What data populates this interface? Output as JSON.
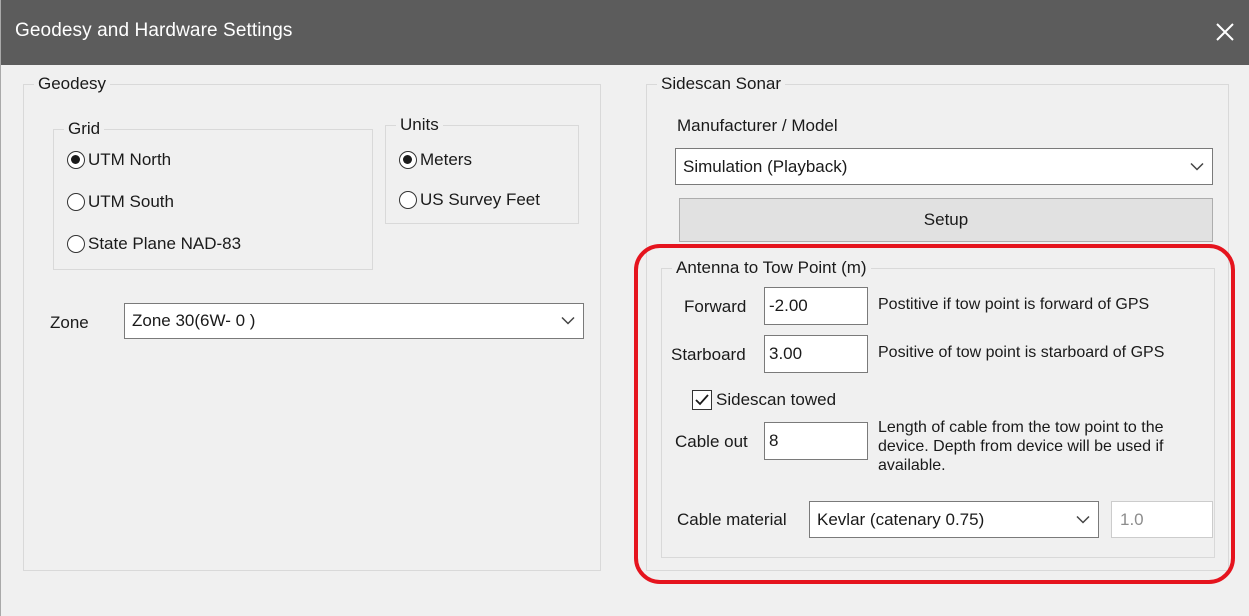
{
  "window": {
    "title": "Geodesy and Hardware Settings"
  },
  "geodesy": {
    "group_label": "Geodesy",
    "grid": {
      "label": "Grid",
      "options": [
        {
          "label": "UTM North",
          "checked": true
        },
        {
          "label": "UTM South",
          "checked": false
        },
        {
          "label": "State Plane NAD-83",
          "checked": false
        }
      ]
    },
    "units": {
      "label": "Units",
      "options": [
        {
          "label": "Meters",
          "checked": true
        },
        {
          "label": "US Survey Feet",
          "checked": false
        }
      ]
    },
    "zone": {
      "label": "Zone",
      "value": "Zone 30(6W- 0 )"
    }
  },
  "sidescan": {
    "group_label": "Sidescan Sonar",
    "manufacturer_label": "Manufacturer / Model",
    "manufacturer_value": "Simulation (Playback)",
    "setup_label": "Setup",
    "antenna": {
      "label": "Antenna to Tow Point (m)",
      "forward": {
        "label": "Forward",
        "value": "-2.00",
        "help": "Postitive if tow point is forward of GPS"
      },
      "starboard": {
        "label": "Starboard",
        "value": "3.00",
        "help": "Positive of tow point is starboard of GPS"
      },
      "towed": {
        "label": "Sidescan towed",
        "checked": true
      },
      "cable_out": {
        "label": "Cable out",
        "value": "8",
        "help": "Length of cable from the tow point to the device. Depth from device will be used if available."
      },
      "cable_material": {
        "label": "Cable material",
        "value": "Kevlar (catenary 0.75)",
        "coefficient": "1.0"
      }
    }
  },
  "colors": {
    "titlebar": "#5c5c5c",
    "highlight": "#e5141e",
    "background": "#f0f0f0"
  }
}
